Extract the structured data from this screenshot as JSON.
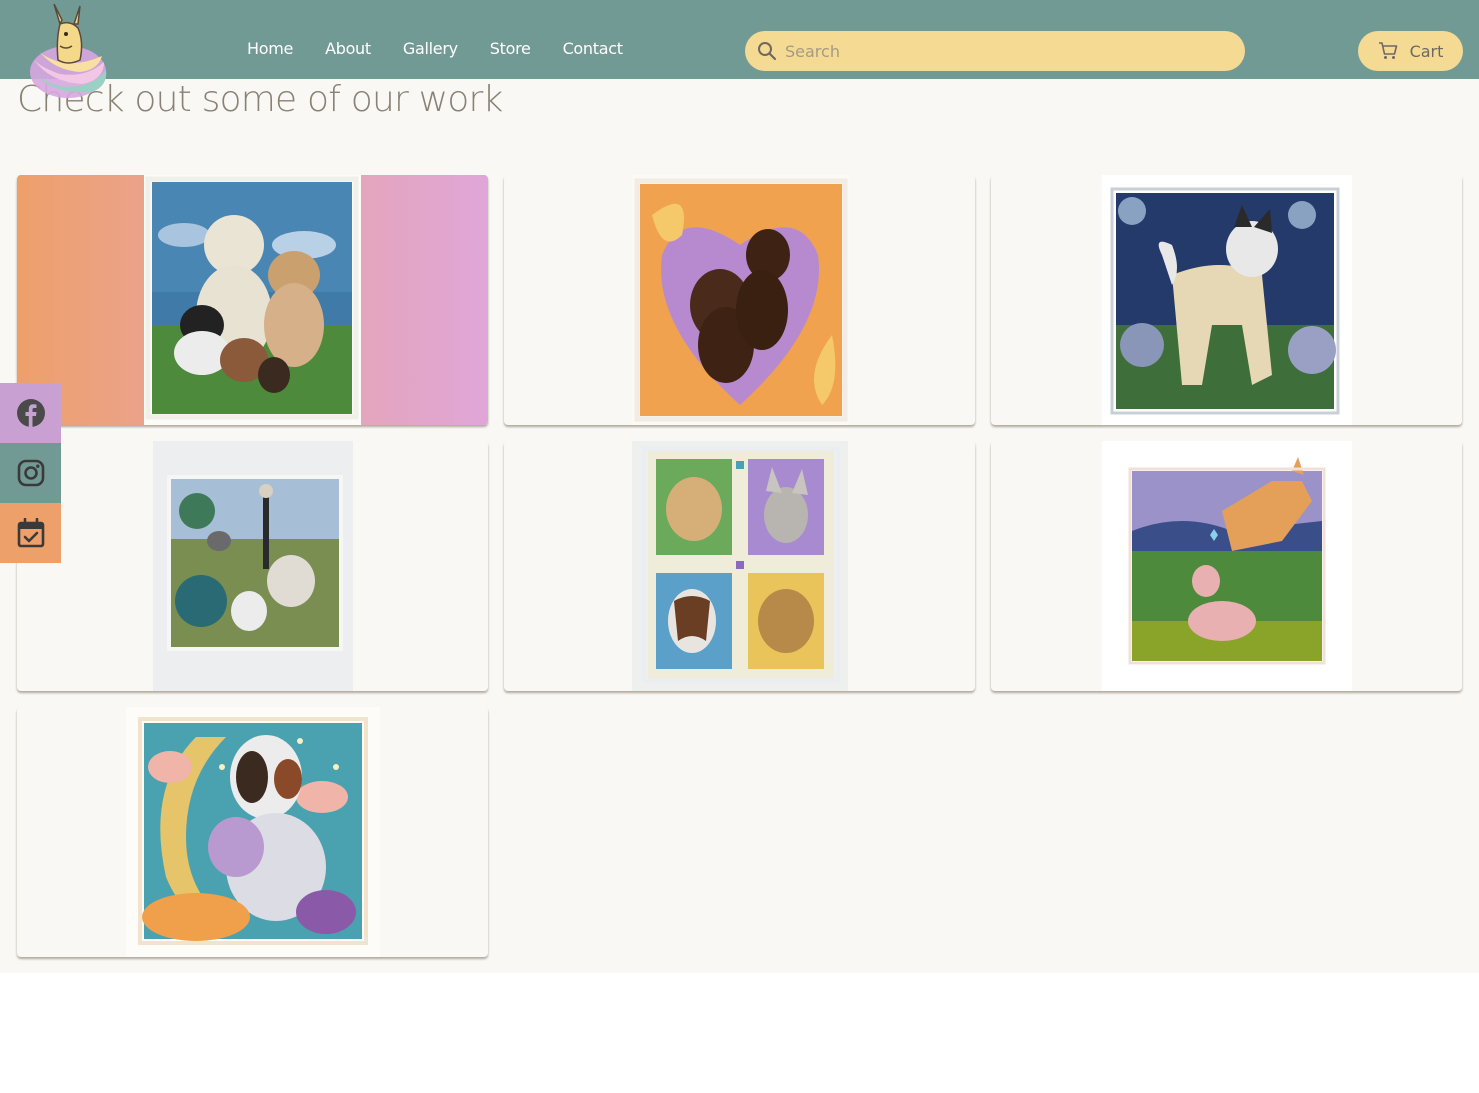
{
  "nav": {
    "items": [
      "Home",
      "About",
      "Gallery",
      "Store",
      "Contact"
    ]
  },
  "search": {
    "placeholder": "Search"
  },
  "cart": {
    "label": "Cart"
  },
  "page": {
    "title": "Check out some of our work"
  },
  "social": {
    "facebook_color": "#c9a0d2",
    "instagram_color": "#729a95",
    "calendar_color": "#eea06a"
  },
  "colors": {
    "header": "#729a95",
    "accent": "#f5da94",
    "background": "#f9f8f4"
  }
}
